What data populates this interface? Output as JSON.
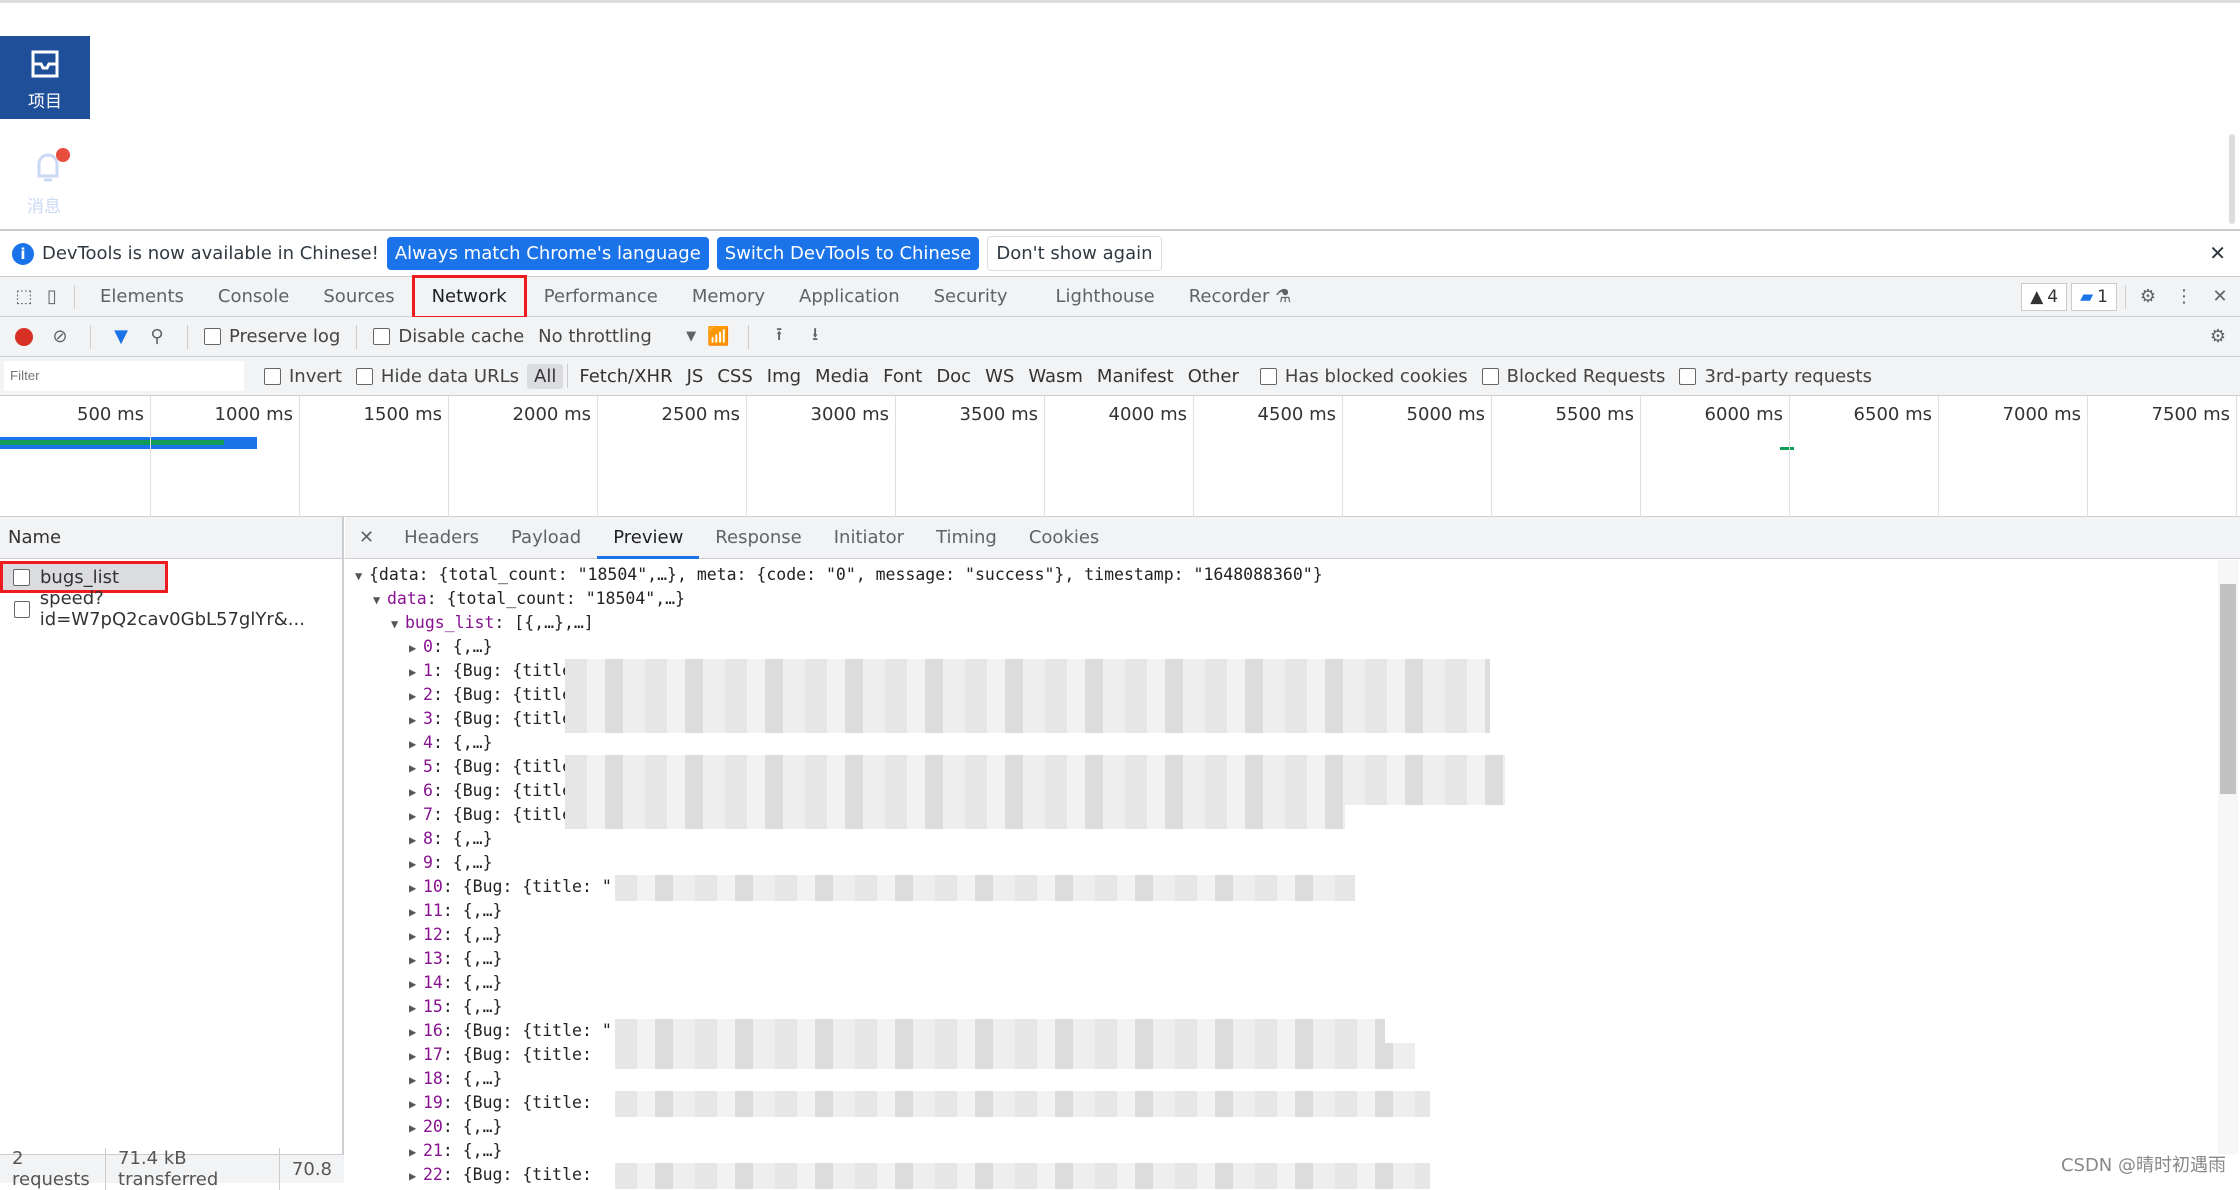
{
  "page": {
    "nav_items": [
      {
        "label": "项目",
        "icon": "inbox-icon"
      },
      {
        "label": "消息",
        "icon": "bell-icon"
      }
    ]
  },
  "infobar": {
    "message": "DevTools is now available in Chinese!",
    "btn_match": "Always match Chrome's language",
    "btn_switch": "Switch DevTools to Chinese",
    "btn_dont": "Don't show again"
  },
  "tabs": [
    "Elements",
    "Console",
    "Sources",
    "Network",
    "Performance",
    "Memory",
    "Application",
    "Security",
    "Lighthouse",
    "Recorder"
  ],
  "selected_tab": "Network",
  "badges": {
    "warnings": "4",
    "messages": "1"
  },
  "toolbar": {
    "preserve_log": "Preserve log",
    "disable_cache": "Disable cache",
    "throttling": "No throttling"
  },
  "filters": {
    "placeholder": "Filter",
    "invert": "Invert",
    "hide_data_urls": "Hide data URLs",
    "types": [
      "All",
      "Fetch/XHR",
      "JS",
      "CSS",
      "Img",
      "Media",
      "Font",
      "Doc",
      "WS",
      "Wasm",
      "Manifest",
      "Other"
    ],
    "has_blocked_cookies": "Has blocked cookies",
    "blocked_requests": "Blocked Requests",
    "third_party": "3rd-party requests"
  },
  "timeline": {
    "ticks": [
      "500 ms",
      "1000 ms",
      "1500 ms",
      "2000 ms",
      "2500 ms",
      "3000 ms",
      "3500 ms",
      "4000 ms",
      "4500 ms",
      "5000 ms",
      "5500 ms",
      "6000 ms",
      "6500 ms",
      "7000 ms",
      "7500 ms"
    ],
    "colors": {
      "bar": "#1a73e8",
      "waiting": "#0f9d58"
    }
  },
  "requests": {
    "header": "Name",
    "items": [
      "bugs_list",
      "speed?id=W7pQ2cav0GbL57glYr&..."
    ]
  },
  "status": {
    "requests": "2 requests",
    "transferred": "71.4 kB transferred",
    "resources": "70.8"
  },
  "detail_tabs": [
    "Headers",
    "Payload",
    "Preview",
    "Response",
    "Initiator",
    "Timing",
    "Cookies"
  ],
  "selected_detail_tab": "Preview",
  "preview": {
    "root": "{data: {total_count: \"18504\",…}, meta: {code: \"0\", message: \"success\"}, timestamp: \"1648088360\"}",
    "data_key": "data",
    "data_val": ": {total_count: \"18504\",…}",
    "list_key": "bugs_list",
    "list_val": ": [{,…},…]",
    "items": [
      {
        "k": "0",
        "v": ": {,…}"
      },
      {
        "k": "1",
        "v": ": {Bug: {title"
      },
      {
        "k": "2",
        "v": ": {Bug: {title"
      },
      {
        "k": "3",
        "v": ": {Bug: {title:"
      },
      {
        "k": "4",
        "v": ": {,…}"
      },
      {
        "k": "5",
        "v": ": {Bug: {title: \""
      },
      {
        "k": "6",
        "v": ": {Bug: {title: \""
      },
      {
        "k": "7",
        "v": ": {Bug: {title: \""
      },
      {
        "k": "8",
        "v": ": {,…}"
      },
      {
        "k": "9",
        "v": ": {,…}"
      },
      {
        "k": "10",
        "v": ": {Bug: {title: \""
      },
      {
        "k": "11",
        "v": ": {,…}"
      },
      {
        "k": "12",
        "v": ": {,…}"
      },
      {
        "k": "13",
        "v": ": {,…}"
      },
      {
        "k": "14",
        "v": ": {,…}"
      },
      {
        "k": "15",
        "v": ": {,…}"
      },
      {
        "k": "16",
        "v": ": {Bug: {title: \""
      },
      {
        "k": "17",
        "v": ": {Bug: {title:"
      },
      {
        "k": "18",
        "v": ": {,…}"
      },
      {
        "k": "19",
        "v": ": {Bug: {title:"
      },
      {
        "k": "20",
        "v": ": {,…}"
      },
      {
        "k": "21",
        "v": ": {,…}"
      },
      {
        "k": "22",
        "v": ": {Bug: {title:"
      }
    ]
  },
  "watermark": "CSDN @晴时初遇雨"
}
